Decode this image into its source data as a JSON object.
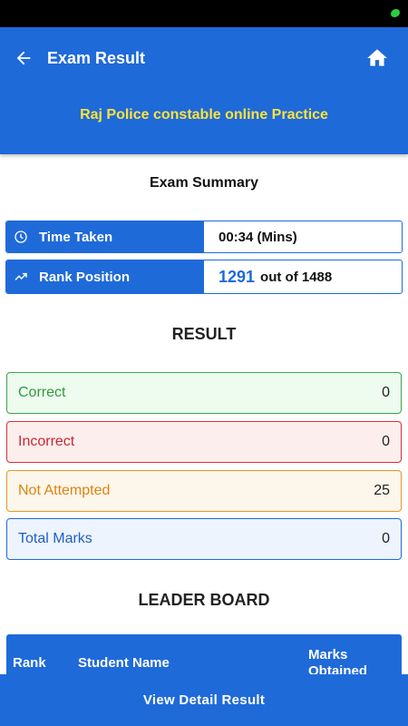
{
  "appbar": {
    "title": "Exam Result",
    "subtitle": "Raj Police constable online Practice",
    "back_icon": "arrow-left-icon",
    "home_icon": "home-icon"
  },
  "summary": {
    "heading": "Exam Summary",
    "time_taken": {
      "label": "Time Taken",
      "value": "00:34 (Mins)",
      "icon": "clock-icon"
    },
    "rank_position": {
      "label": "Rank Position",
      "rank": "1291",
      "suffix": "out of 1488",
      "icon": "trending-up-icon"
    }
  },
  "result": {
    "heading": "RESULT",
    "correct": {
      "label": "Correct",
      "value": "0"
    },
    "incorrect": {
      "label": "Incorrect",
      "value": "0"
    },
    "not_attempted": {
      "label": "Not Attempted",
      "value": "25"
    },
    "total_marks": {
      "label": "Total Marks",
      "value": "0"
    }
  },
  "leaderboard": {
    "heading": "LEADER BOARD",
    "columns": [
      "Rank",
      "Student Name",
      "Marks Obtained"
    ]
  },
  "footer": {
    "button_label": "View Detail Result"
  },
  "colors": {
    "primary": "#1f6ad9",
    "subtitle": "#ffe23a",
    "correct": "#3aa64a",
    "incorrect": "#d9303a",
    "not_attempted": "#e8962a"
  }
}
